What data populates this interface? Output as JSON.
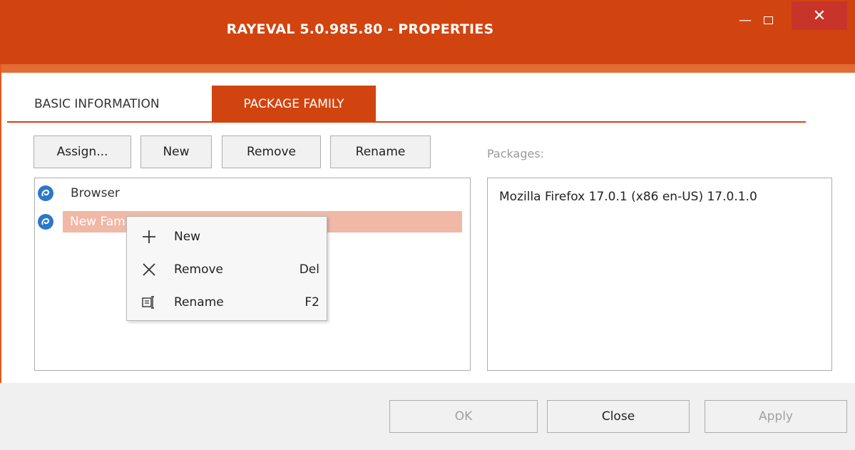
{
  "window": {
    "title": "RAYEVAL 5.0.985.80 - PROPERTIES",
    "controls": {
      "minimize": "—",
      "close": "✕"
    },
    "accent": "#d2440f"
  },
  "tabs": [
    {
      "label": "BASIC INFORMATION",
      "active": false
    },
    {
      "label": "PACKAGE FAMILY",
      "active": true
    }
  ],
  "toolbar": {
    "assign_label": "Assign...",
    "new_label": "New",
    "remove_label": "Remove",
    "rename_label": "Rename"
  },
  "families": {
    "items": [
      {
        "label": "Browser",
        "icon": "family-icon"
      },
      {
        "label": "New Family",
        "icon": "family-icon",
        "selected": true
      }
    ]
  },
  "packages": {
    "label": "Packages:",
    "items": [
      "Mozilla Firefox 17.0.1 (x86 en-US) 17.0.1.0"
    ]
  },
  "context_menu": {
    "items": [
      {
        "label": "New",
        "shortcut": "",
        "icon": "plus-icon"
      },
      {
        "label": "Remove",
        "shortcut": "Del",
        "icon": "x-icon"
      },
      {
        "label": "Rename",
        "shortcut": "F2",
        "icon": "rename-icon"
      }
    ]
  },
  "footer": {
    "ok_label": "OK",
    "close_label": "Close",
    "apply_label": "Apply"
  }
}
